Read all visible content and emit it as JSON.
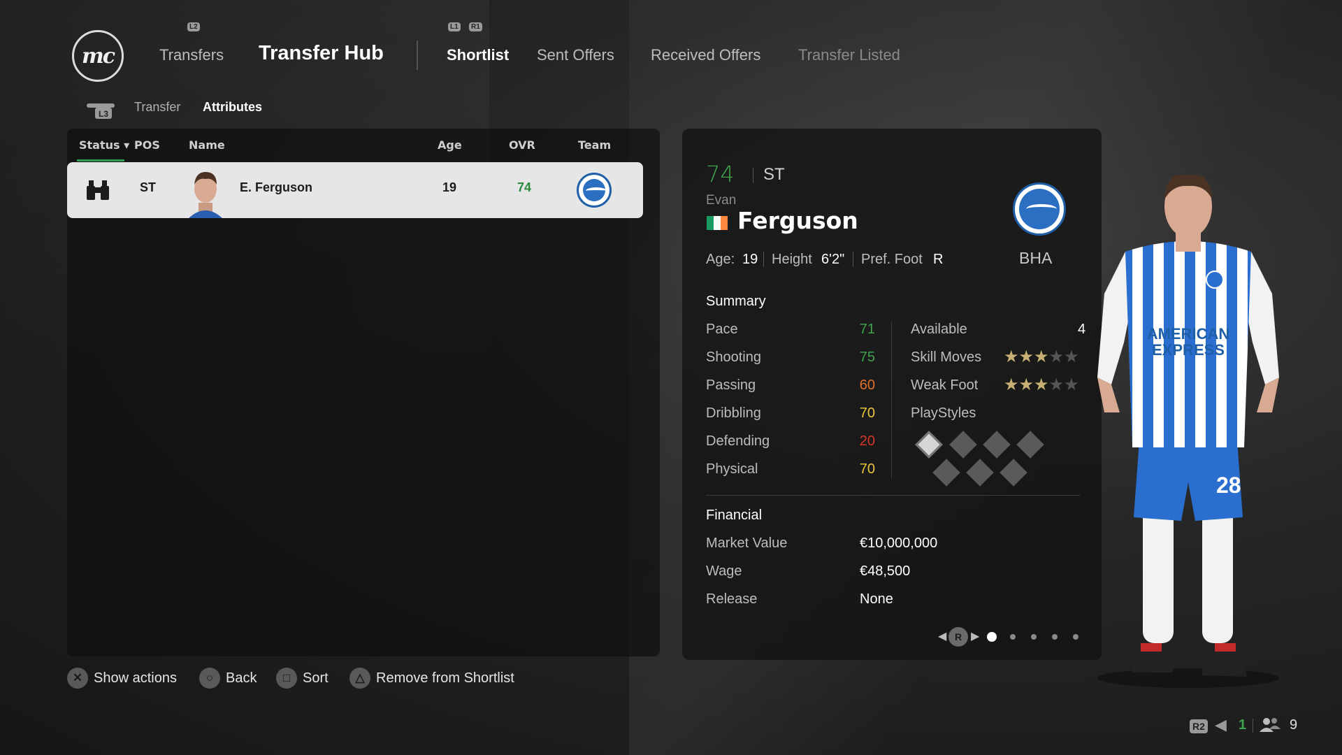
{
  "header": {
    "logo_text": "mc",
    "transfers_label": "Transfers",
    "title": "Transfer Hub",
    "l2_hint": "L2",
    "l1_hint": "L1",
    "r1_hint": "R1",
    "tabs": [
      {
        "label": "Shortlist",
        "active": true
      },
      {
        "label": "Sent Offers",
        "active": false
      },
      {
        "label": "Received Offers",
        "active": false
      },
      {
        "label": "Transfer Listed",
        "active": false
      }
    ]
  },
  "sub_tabs": {
    "l3_hint": "L3",
    "items": [
      {
        "label": "Transfer",
        "active": false
      },
      {
        "label": "Attributes",
        "active": true
      }
    ]
  },
  "table": {
    "headers": {
      "status": "Status",
      "pos": "POS",
      "name": "Name",
      "age": "Age",
      "ovr": "OVR",
      "team": "Team"
    },
    "rows": [
      {
        "status_icon": "binoculars-icon",
        "pos": "ST",
        "name": "E. Ferguson",
        "age": "19",
        "ovr": "74",
        "team_badge": "brighton-crest"
      }
    ]
  },
  "player": {
    "ovr": "74",
    "position": "ST",
    "first_name": "Evan",
    "last_name": "Ferguson",
    "nation_flag": "ireland-flag",
    "club_short": "BHA",
    "age_label": "Age:",
    "age": "19",
    "height_label": "Height",
    "height": "6'2\"",
    "foot_label": "Pref. Foot",
    "foot": "R"
  },
  "summary": {
    "title": "Summary",
    "stats": [
      {
        "label": "Pace",
        "value": "71",
        "color": "#3fa34d"
      },
      {
        "label": "Shooting",
        "value": "75",
        "color": "#3fa34d"
      },
      {
        "label": "Passing",
        "value": "60",
        "color": "#e0702a"
      },
      {
        "label": "Dribbling",
        "value": "70",
        "color": "#e7c53a"
      },
      {
        "label": "Defending",
        "value": "20",
        "color": "#d8352a"
      },
      {
        "label": "Physical",
        "value": "70",
        "color": "#e7c53a"
      }
    ],
    "available_label": "Available",
    "available_value": "4",
    "skill_moves_label": "Skill Moves",
    "skill_moves_stars": 3,
    "weak_foot_label": "Weak Foot",
    "weak_foot_stars": 3,
    "max_stars": 5,
    "playstyles_label": "PlayStyles"
  },
  "financial": {
    "title": "Financial",
    "rows": [
      {
        "label": "Market Value",
        "value": "€10,000,000"
      },
      {
        "label": "Wage",
        "value": "€48,500"
      },
      {
        "label": "Release",
        "value": "None"
      }
    ]
  },
  "pager": {
    "hint": "R",
    "pages": 5,
    "current": 1
  },
  "actions": [
    {
      "icon": "cross-icon",
      "glyph": "✕",
      "label": "Show actions"
    },
    {
      "icon": "circle-icon",
      "glyph": "○",
      "label": "Back"
    },
    {
      "icon": "square-icon",
      "glyph": "□",
      "label": "Sort"
    },
    {
      "icon": "triangle-icon",
      "glyph": "△",
      "label": "Remove from Shortlist"
    }
  ],
  "footer": {
    "r2_hint": "R2",
    "count_green": "1",
    "count_users": "9"
  },
  "colors": {
    "accent_green": "#3fa34d",
    "club_blue": "#1e5fa8"
  }
}
